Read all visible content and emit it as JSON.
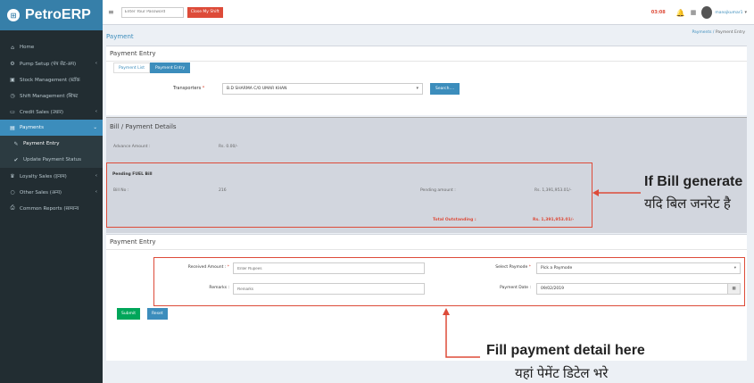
{
  "app": {
    "brand": "PetroERP",
    "brand_icon": "store-icon"
  },
  "sidebar": {
    "items": [
      {
        "label": "Home",
        "icon": "home-icon"
      },
      {
        "label": "Pump Setup (पंप सेट-अप)",
        "icon": "cogs-icon",
        "arrow": "‹"
      },
      {
        "label": "Stock Management (स्टॉक",
        "icon": "cubes-icon"
      },
      {
        "label": "Shift Management (शिफ्ट",
        "icon": "clock-icon"
      },
      {
        "label": "Credit Sales (उधार)",
        "icon": "credit-card-icon",
        "arrow": "‹"
      },
      {
        "label": "Payments",
        "icon": "money-icon",
        "arrow": "⌄"
      },
      {
        "label": "Payment Entry",
        "icon": "edit-icon"
      },
      {
        "label": "Update Payment Status",
        "icon": "check-icon"
      },
      {
        "label": "Loyalty Sales (इनाम)",
        "icon": "trophy-icon",
        "arrow": "‹"
      },
      {
        "label": "Other Sales (अन्य)",
        "icon": "circle-icon",
        "arrow": "‹"
      },
      {
        "label": "Common Reports (सामान्य",
        "icon": "print-icon"
      }
    ]
  },
  "navbar": {
    "password_placeholder": "Enter Your Password",
    "close_shift_label": "Close My Shift",
    "clock": "03:08",
    "user_name": "manojkumar1"
  },
  "page": {
    "title": "Payment",
    "breadcrumb": {
      "parent": "Payments",
      "separator": "/",
      "current": "Payment Entry"
    }
  },
  "entry_box": {
    "title": "Payment Entry",
    "tabs": [
      "Payment List",
      "Payment Entry"
    ],
    "transporter_label": "Transporters",
    "transporter_value": "B.D SHARMA C/O UMAR KHAN",
    "search_label": "Search...."
  },
  "bill_box": {
    "title": "Bill / Payment Details",
    "advance_label": "Advance Amount :",
    "advance_value": "Rs. 0.00/-",
    "pending_title": "Pending FUEL Bill",
    "bill_no_label": "Bill No :",
    "bill_no_value": "216",
    "pending_amount_label": "Pending amount :",
    "pending_amount_value": "Rs. 1,391,953.01/-",
    "total_label": "Total Outstanding :",
    "total_value": "Rs. 1,391,953.01/-"
  },
  "payment_form": {
    "title": "Payment Entry",
    "received_label": "Received Amount :",
    "received_placeholder": "Enter Rupees",
    "paymode_label": "Select Paymode",
    "paymode_value": "Pick a Paymode",
    "remarks_label": "Remarks :",
    "remarks_placeholder": "Remarks",
    "date_label": "Payment Date :",
    "date_value": "09/02/2019",
    "submit_label": "Submit",
    "reset_label": "Reset"
  },
  "annotations": {
    "bill_en": "If Bill generate",
    "bill_hi": "यदि बिल जनरेट है",
    "fill_en": "Fill payment detail here",
    "fill_hi": "यहां पेमेंट डिटेल भरे"
  },
  "colors": {
    "primary": "#3c8dbc",
    "sidebar": "#222d32",
    "danger": "#dd4b39",
    "success": "#00a65a"
  }
}
